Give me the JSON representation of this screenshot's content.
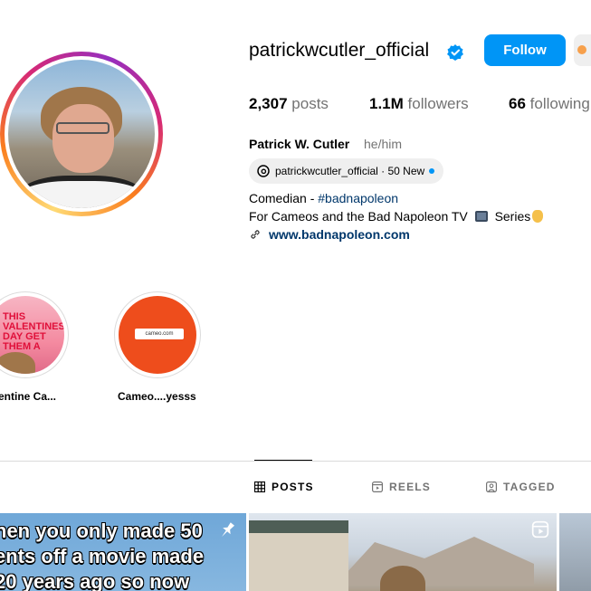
{
  "profile": {
    "username": "patrickwcutler_official",
    "follow_label": "Follow",
    "stats": {
      "posts_count": "2,307",
      "posts_label": "posts",
      "followers_count": "1.1M",
      "followers_label": "followers",
      "following_count": "66",
      "following_label": "following"
    },
    "full_name": "Patrick W. Cutler",
    "pronouns": "he/him",
    "threads_badge": "patrickwcutler_official · 50 New",
    "bio": {
      "line1_prefix": "Comedian - ",
      "line1_hashtag": "#badnapoleon",
      "line2_prefix": "For Cameos and the Bad Napoleon TV",
      "line2_suffix": "Series"
    },
    "link": "www.badnapoleon.com"
  },
  "highlights": [
    {
      "label": "entine Ca...",
      "cover_text": "THIS VALENTINES DAY GET THEM A"
    },
    {
      "label": "Cameo....yesss",
      "cover_text": "cameo.com"
    }
  ],
  "tabs": [
    {
      "label": "POSTS",
      "icon": "grid-icon",
      "active": true
    },
    {
      "label": "REELS",
      "icon": "reels-icon",
      "active": false
    },
    {
      "label": "TAGGED",
      "icon": "tagged-icon",
      "active": false
    }
  ],
  "posts": {
    "post1_caption": [
      "hen you only made 50",
      "ents off a movie made",
      "20 years ago so now"
    ]
  },
  "colors": {
    "primary_button": "#0095f6",
    "link": "#00376b",
    "muted_text": "#737373"
  }
}
